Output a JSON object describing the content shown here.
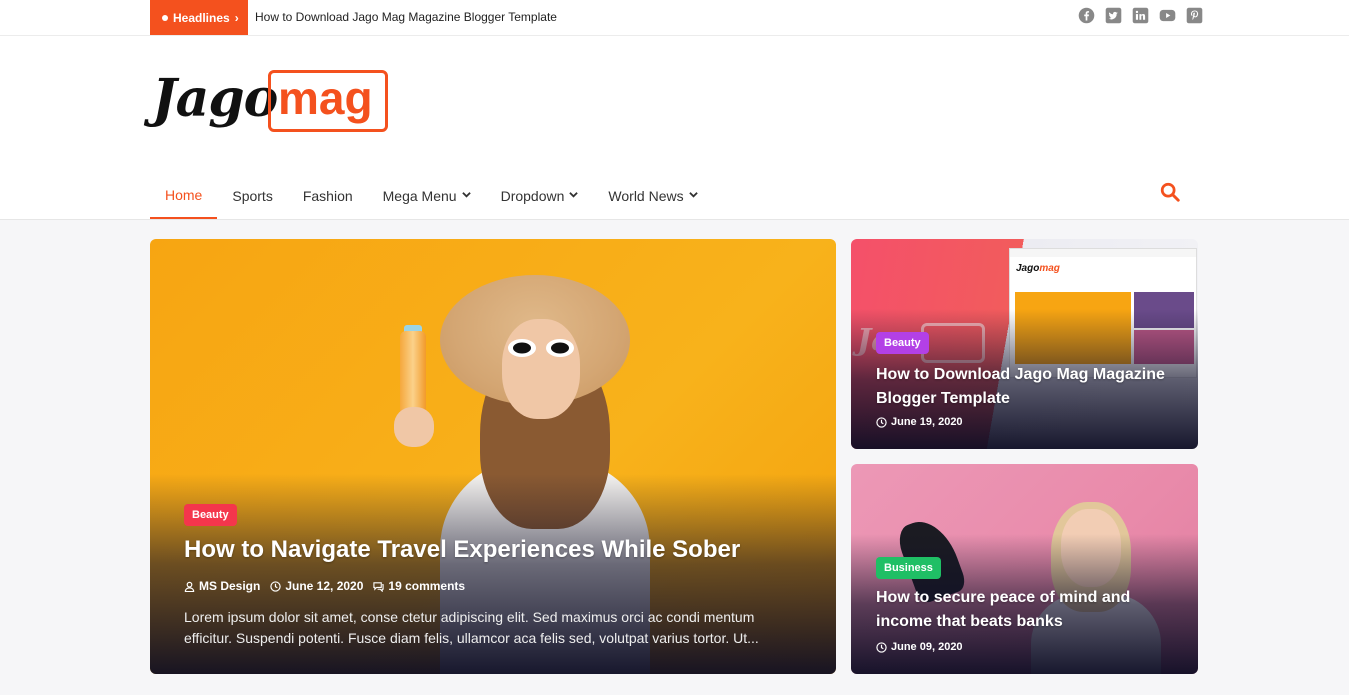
{
  "topbar": {
    "headlines_label": "Headlines",
    "ticker_text": "How to Download Jago Mag Magazine Blogger Template",
    "social_icons": [
      "facebook-icon",
      "twitter-icon",
      "linkedin-icon",
      "youtube-icon",
      "pinterest-icon"
    ]
  },
  "logo": {
    "part1": "Jago",
    "part2": "mag"
  },
  "nav": {
    "items": [
      {
        "label": "Home",
        "active": true,
        "dropdown": false
      },
      {
        "label": "Sports",
        "active": false,
        "dropdown": false
      },
      {
        "label": "Fashion",
        "active": false,
        "dropdown": false
      },
      {
        "label": "Mega Menu",
        "active": false,
        "dropdown": true
      },
      {
        "label": "Dropdown",
        "active": false,
        "dropdown": true
      },
      {
        "label": "World News",
        "active": false,
        "dropdown": true
      }
    ],
    "search_icon": "search-icon"
  },
  "featured": {
    "category": "Beauty",
    "title": "How to Navigate Travel Experiences While Sober",
    "author": "MS Design",
    "date": "June 12, 2020",
    "comments": "19 comments",
    "excerpt": "Lorem ipsum dolor sit amet, conse ctetur adipiscing elit. Sed maximus orci ac condi mentum efficitur. Suspendi potenti. Fusce diam felis, ullamcor aca felis sed, volutpat varius tortor. Ut..."
  },
  "side_posts": [
    {
      "category": "Beauty",
      "title": "How to Download Jago Mag Magazine Blogger Template",
      "date": "June 19, 2020"
    },
    {
      "category": "Business",
      "title": "How to secure peace of mind and income that beats banks",
      "date": "June 09, 2020"
    }
  ],
  "colors": {
    "accent": "#f4511e",
    "badge_beauty_main": "#f4364c",
    "badge_beauty_side": "#b340e6",
    "badge_business": "#1fbf65"
  }
}
